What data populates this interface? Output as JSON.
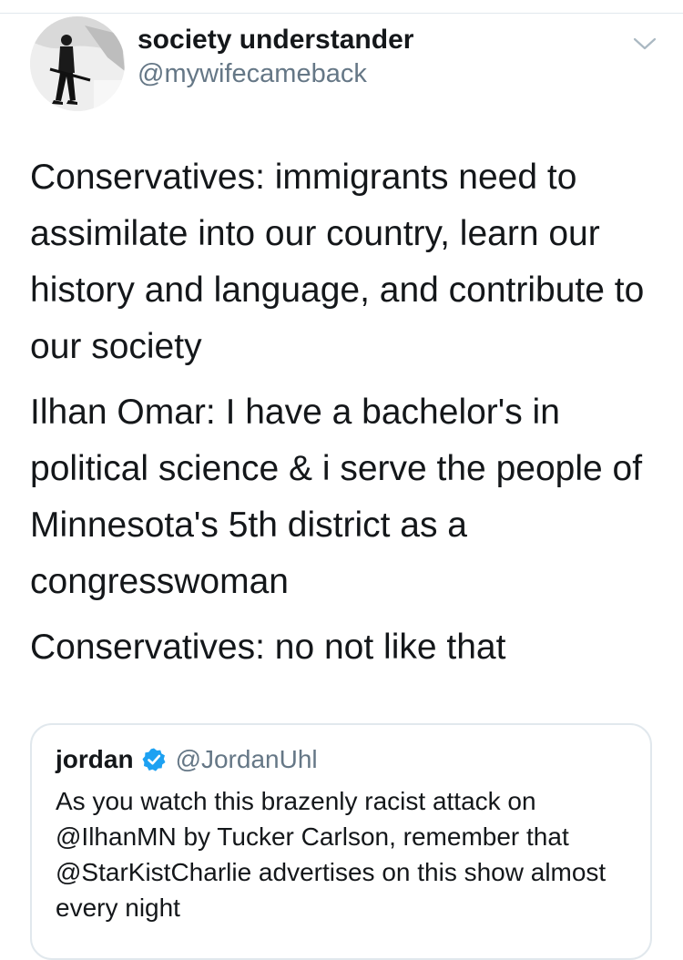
{
  "tweet": {
    "author": {
      "display_name": "society understander",
      "handle": "@mywifecameback",
      "avatar_icon": "avatar-soldier-photo"
    },
    "menu_icon": "chevron-down-icon",
    "paragraphs": [
      "Conservatives: immigrants need to assimilate into our country, learn our history and language, and contribute to our society",
      "Ilhan Omar: I have a bachelor's in political science & i serve the people of Minnesota's 5th district as a congresswoman",
      "Conservatives: no not like that"
    ]
  },
  "quoted_tweet": {
    "author_name": "jordan",
    "verified_icon": "verified-badge-icon",
    "handle": "@JordanUhl",
    "text": "As you watch this brazenly racist attack on @IlhanMN by Tucker Carlson, remember that @StarKistCharlie advertises on this show almost every night"
  },
  "colors": {
    "text_primary": "#14171a",
    "text_secondary": "#657786",
    "border": "#e1e8ed",
    "verified_blue": "#1da1f2"
  }
}
